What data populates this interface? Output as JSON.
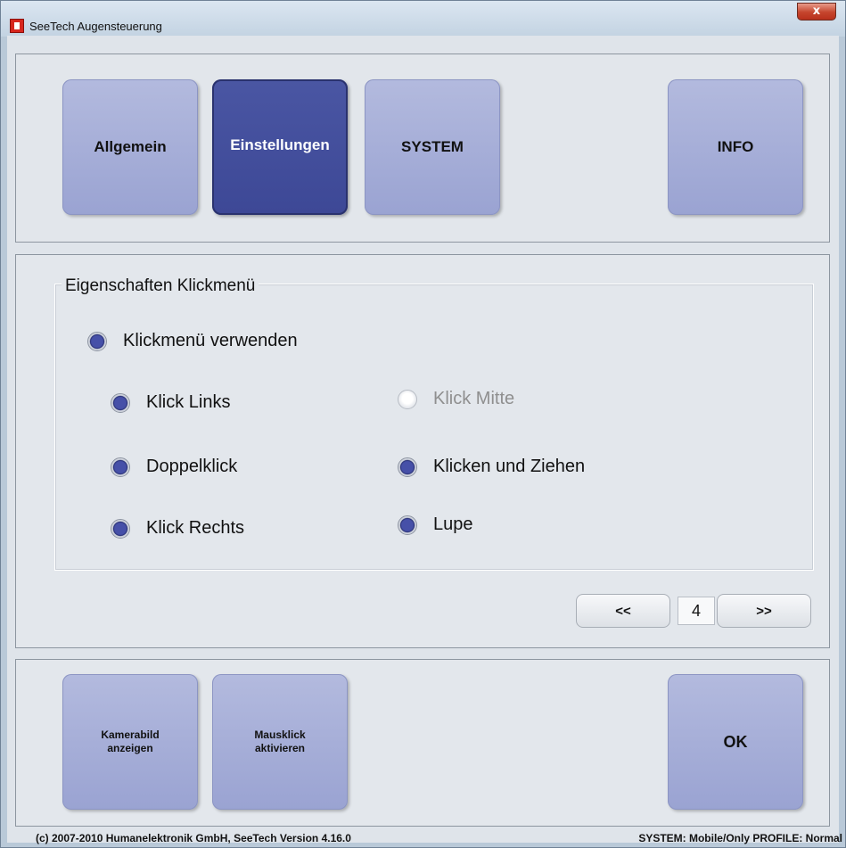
{
  "window": {
    "title": "SeeTech Augensteuerung",
    "close_label": "x"
  },
  "top_nav": {
    "tabs": [
      {
        "label": "Allgemein",
        "active": false
      },
      {
        "label": "Einstellungen",
        "active": true
      },
      {
        "label": "SYSTEM",
        "active": false
      },
      {
        "label": "INFO",
        "active": false
      }
    ]
  },
  "settings": {
    "group_title": "Eigenschaften Klickmenü",
    "use_menu": {
      "label": "Klickmenü verwenden",
      "checked": true
    },
    "options_left": [
      {
        "label": "Klick Links",
        "checked": true,
        "enabled": true
      },
      {
        "label": "Doppelklick",
        "checked": true,
        "enabled": true
      },
      {
        "label": "Klick Rechts",
        "checked": true,
        "enabled": true
      }
    ],
    "options_right": [
      {
        "label": "Klick Mitte",
        "checked": false,
        "enabled": false
      },
      {
        "label": "Klicken und Ziehen",
        "checked": true,
        "enabled": true
      },
      {
        "label": "Lupe",
        "checked": true,
        "enabled": true
      }
    ]
  },
  "pager": {
    "prev_label": "<<",
    "page": "4",
    "next_label": ">>"
  },
  "bottom_buttons": {
    "camera_line1": "Kamerabild",
    "camera_line2": "anzeigen",
    "mouseclick_line1": "Mausklick",
    "mouseclick_line2": "aktivieren",
    "ok_label": "OK"
  },
  "status": {
    "copyright": "(c) 2007-2010 Humanelektronik GmbH, SeeTech Version 4.16.0",
    "system_profile": "SYSTEM: Mobile/Only  PROFILE: Normal"
  },
  "colors": {
    "button_bg": "#a1a9d5",
    "button_active_bg": "#434f9d",
    "radio_fill": "#4650a8"
  }
}
